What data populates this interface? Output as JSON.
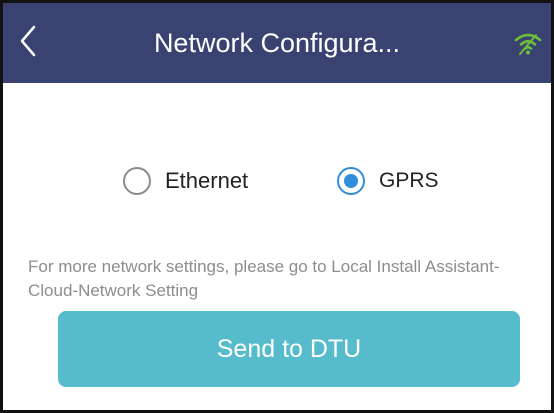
{
  "header": {
    "title": "Network Configura...",
    "back_icon": "chevron-left-icon",
    "status_icon": "wifi-icon",
    "background_color": "#3a4272"
  },
  "network_options": [
    {
      "label": "Ethernet",
      "selected": false
    },
    {
      "label": "GPRS",
      "selected": true
    }
  ],
  "note": "For more network settings, please go to Local Install Assistant-Cloud-Network Setting",
  "send_button": {
    "label": "Send to DTU",
    "color": "#56bccb"
  },
  "accent_color": "#2f8fdc"
}
